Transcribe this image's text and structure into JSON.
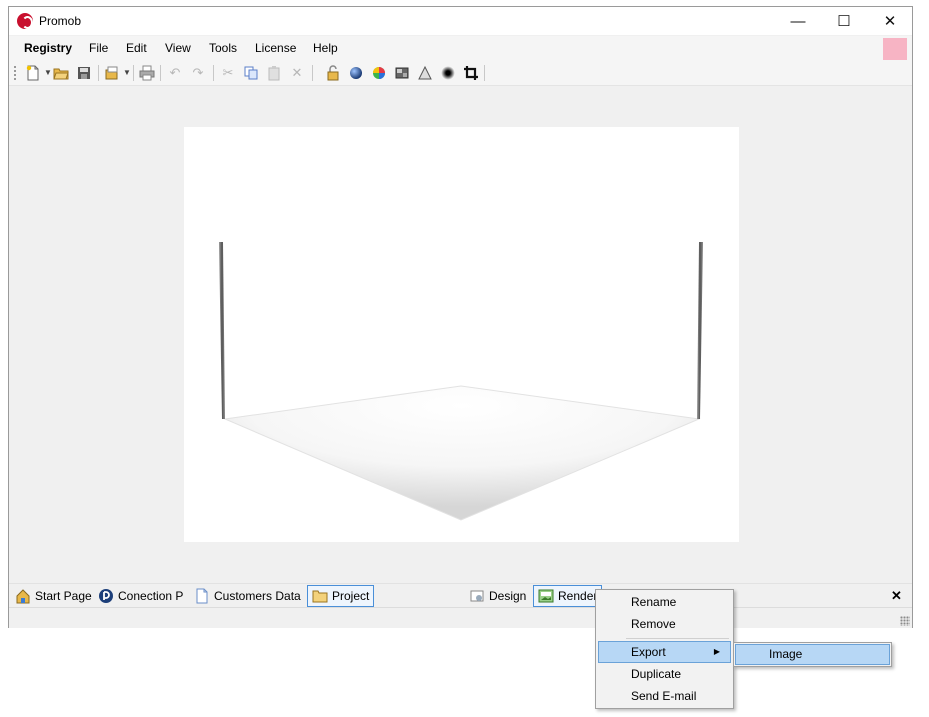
{
  "window": {
    "title": "Promob",
    "minimize": "—",
    "maximize": "☐",
    "close": "✕"
  },
  "menu": [
    "Registry",
    "File",
    "Edit",
    "View",
    "Tools",
    "License",
    "Help"
  ],
  "toolbar": {
    "icons": [
      "new-document-icon",
      "open-folder-icon",
      "save-icon",
      "object-library-icon",
      "print-icon",
      "undo-icon",
      "redo-icon",
      "cut-icon",
      "copy-icon",
      "paste-icon",
      "delete-icon",
      "lock-icon",
      "sphere-blue-icon",
      "sphere-color-icon",
      "texture-icon",
      "prism-icon",
      "shadow-icon",
      "crop-icon"
    ]
  },
  "tabs": {
    "start_page": "Start Page",
    "connection": "Conection P",
    "customers": "Customers Data",
    "project": "Project",
    "design": "Design",
    "render": "Render",
    "close": "✕"
  },
  "context_menu": {
    "items": [
      "Rename",
      "Remove",
      "Export",
      "Duplicate",
      "Send E-mail"
    ],
    "submenu_arrow": "▶",
    "submenu_item": "Image"
  },
  "colors": {
    "accent_pink": "#f7b4c4",
    "highlight": "#b7d7f5",
    "highlight_border": "#6aa2d8",
    "brand_red": "#c8102e"
  }
}
